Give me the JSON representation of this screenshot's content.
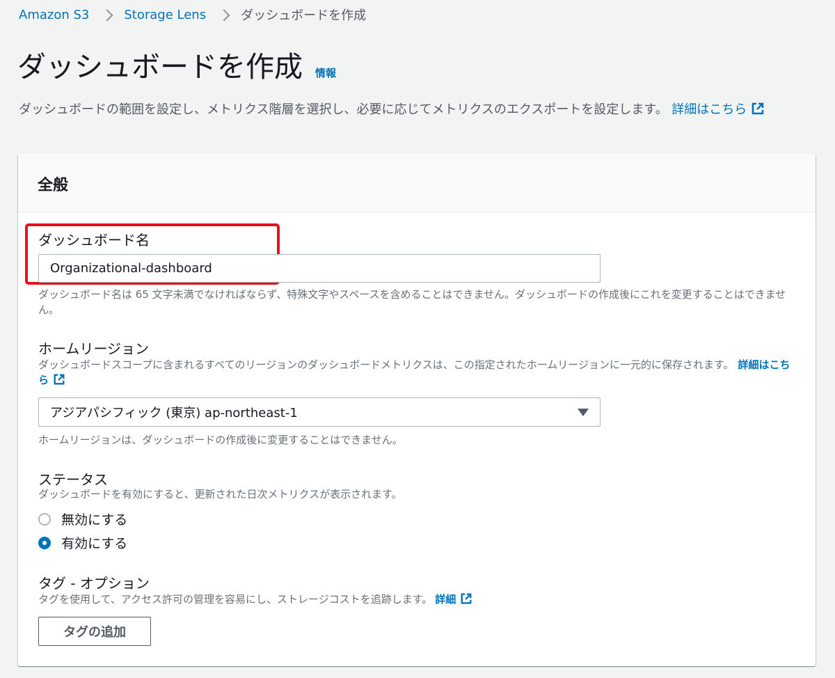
{
  "breadcrumb": {
    "items": [
      "Amazon S3",
      "Storage Lens"
    ],
    "current": "ダッシュボードを作成"
  },
  "page": {
    "title": "ダッシュボードを作成",
    "info_link": "情報",
    "description": "ダッシュボードの範囲を設定し、メトリクス階層を選択し、必要に応じてメトリクスのエクスポートを設定します。",
    "details_link": "詳細はこちら"
  },
  "general": {
    "heading": "全般",
    "dashboard_name": {
      "label": "ダッシュボード名",
      "value": "Organizational-dashboard",
      "hint": "ダッシュボード名は 65 文字未満でなければならず、特殊文字やスペースを含めることはできません。ダッシュボードの作成後にこれを変更することはできません。"
    },
    "home_region": {
      "label": "ホームリージョン",
      "description": "ダッシュボードスコープに含まれるすべてのリージョンのダッシュボードメトリクスは、この指定されたホームリージョンに一元的に保存されます。",
      "details_link": "詳細はこちら",
      "selected": "アジアパシフィック (東京) ap-northeast-1",
      "hint": "ホームリージョンは、ダッシュボードの作成後に変更することはできません。"
    },
    "status": {
      "label": "ステータス",
      "description": "ダッシュボードを有効にすると、更新された日次メトリクスが表示されます。",
      "options": [
        {
          "label": "無効にする",
          "checked": false
        },
        {
          "label": "有効にする",
          "checked": true
        }
      ]
    },
    "tags": {
      "label": "タグ - オプション",
      "description": "タグを使用して、アクセス許可の管理を容易にし、ストレージコストを追跡します。",
      "details_link": "詳細",
      "add_button": "タグの追加"
    }
  },
  "colors": {
    "link": "#0073bb",
    "highlight": "#e8101a",
    "background": "#f2f3f3"
  }
}
